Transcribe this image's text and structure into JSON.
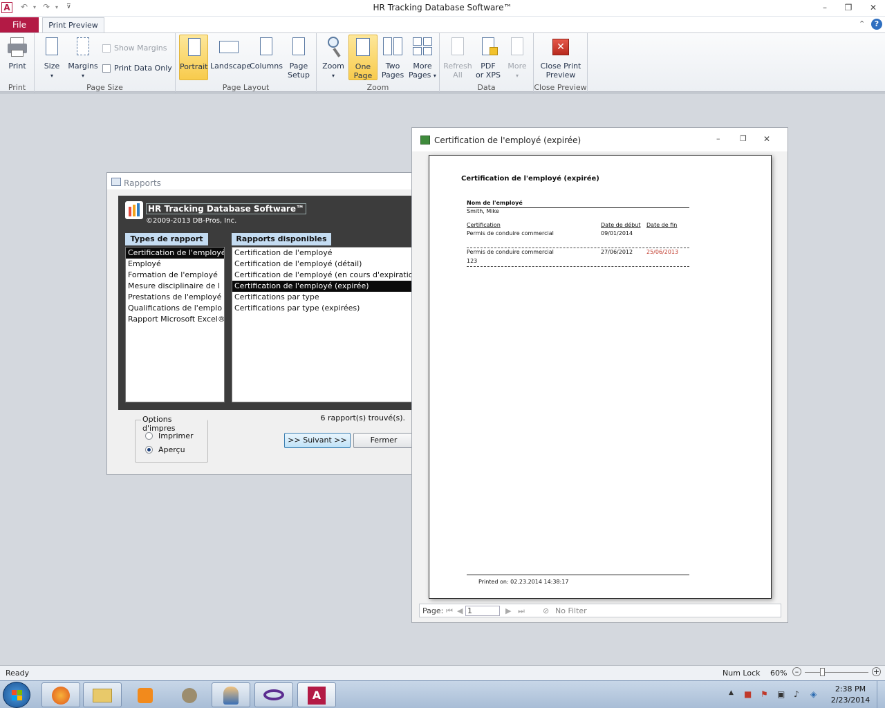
{
  "app": {
    "title": "HR Tracking Database Software™",
    "icon_letter": "A"
  },
  "tabs": {
    "file": "File",
    "print_preview": "Print Preview"
  },
  "ribbon": {
    "groups": {
      "print": "Print",
      "page_size": "Page Size",
      "page_layout": "Page Layout",
      "zoom": "Zoom",
      "data": "Data",
      "close_preview": "Close Preview"
    },
    "buttons": {
      "print": "Print",
      "size": "Size",
      "margins": "Margins",
      "show_margins": "Show Margins",
      "print_data_only": "Print Data Only",
      "portrait": "Portrait",
      "landscape": "Landscape",
      "columns": "Columns",
      "page_setup_1": "Page",
      "page_setup_2": "Setup",
      "zoom": "Zoom",
      "one_page_1": "One",
      "one_page_2": "Page",
      "two_pages_1": "Two",
      "two_pages_2": "Pages",
      "more_pages_1": "More",
      "more_pages_2": "Pages",
      "refresh_1": "Refresh",
      "refresh_2": "All",
      "pdf_1": "PDF",
      "pdf_2": "or XPS",
      "more": "More",
      "close_print_1": "Close Print",
      "close_print_2": "Preview"
    }
  },
  "rapports": {
    "window_title": "Rapports",
    "header_title": "HR Tracking Database Software™",
    "copyright": "©2009-2013 DB-Pros, Inc.",
    "types_header": "Types de rapport",
    "available_header": "Rapports disponibles",
    "types": [
      "Certification de l'employé",
      "Employé",
      "Formation de l'employé",
      "Mesure disciplinaire de l",
      "Prestations de l'employé",
      "Qualifications de l'emplo",
      "Rapport Microsoft Excel®"
    ],
    "reports": [
      "Certification de l'employé",
      "Certification de l'employé (détail)",
      "Certification de l'employé (en cours d'expiratio",
      "Certification de l'employé (expirée)",
      "Certifications par type",
      "Certifications par type (expirées)"
    ],
    "selected_type_index": 0,
    "selected_report_index": 3,
    "found_text": "6 rapport(s) trouvé(s).",
    "options_legend": "Options d'impres",
    "option_print": "Imprimer",
    "option_preview": "Aperçu",
    "next_button": ">> Suivant >>",
    "close_button": "Fermer"
  },
  "preview": {
    "window_title": "Certification de l'employé (expirée)",
    "report": {
      "title": "Certification de l'employé (expirée)",
      "employee_label": "Nom de l'employé",
      "employee_name": "Smith, Mike",
      "col_cert": "Certification",
      "col_start": "Date de début",
      "col_end": "Date de fin",
      "row1_cert": "Permis de conduire commercial",
      "row1_start": "09/01/2014",
      "row2_cert": "Permis de conduire commercial",
      "row2_start": "27/06/2012",
      "row2_end": "25/06/2013",
      "row2_note": "123",
      "footer": "Printed on: 02.23.2014 14:38:17"
    },
    "nav": {
      "page_label": "Page:",
      "page_value": "1",
      "no_filter": "No Filter"
    }
  },
  "statusbar": {
    "ready": "Ready",
    "num_lock": "Num Lock",
    "zoom": "60%"
  },
  "taskbar": {
    "time": "2:38 PM",
    "date": "2/23/2014"
  },
  "colors": {
    "file_tab": "#b31a45",
    "active_button": "#f8cb4c",
    "expired_red": "#c0392b",
    "selection": "#0a0a0a"
  }
}
